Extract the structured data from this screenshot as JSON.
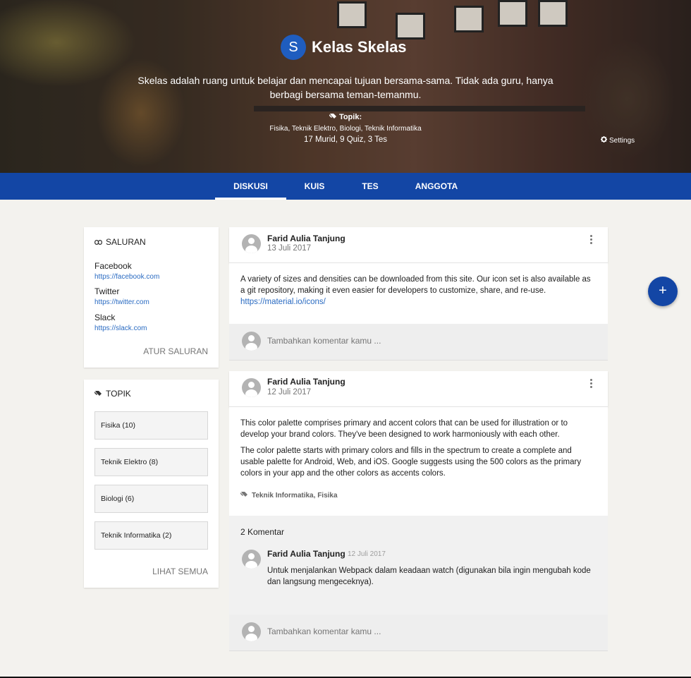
{
  "hero": {
    "avatar_letter": "S",
    "title": "Kelas Skelas",
    "description": "Skelas adalah ruang untuk belajar dan mencapai tujuan bersama-sama. Tidak ada guru, hanya berbagi bersama teman-temanmu.",
    "topic_label": "Topik:",
    "topics": "Fisika, Teknik Elektro, Biologi, Teknik Informatika",
    "stats": "17 Murid, 9 Quiz, 3 Tes",
    "settings_label": "Settings"
  },
  "tabs": [
    {
      "label": "DISKUSI",
      "active": true
    },
    {
      "label": "KUIS",
      "active": false
    },
    {
      "label": "TES",
      "active": false
    },
    {
      "label": "ANGGOTA",
      "active": false
    }
  ],
  "sidebar": {
    "channels": {
      "title": "SALURAN",
      "items": [
        {
          "name": "Facebook",
          "url": "https://facebook.com"
        },
        {
          "name": "Twitter",
          "url": "https://twitter.com"
        },
        {
          "name": "Slack",
          "url": "https://slack.com"
        }
      ],
      "action": "ATUR SALURAN"
    },
    "topics": {
      "title": "TOPIK",
      "items": [
        "Fisika (10)",
        "Teknik Elektro (8)",
        "Biologi (6)",
        "Teknik Informatika (2)"
      ],
      "action": "LIHAT SEMUA"
    }
  },
  "posts": [
    {
      "author": "Farid Aulia Tanjung",
      "date": "13 Juli 2017",
      "body": "A variety of sizes and densities can be downloaded from this site. Our icon set is also available as a git repository, making it even easier for developers to customize, share, and re-use.",
      "link": "https://material.io/icons/",
      "comment_placeholder": "Tambahkan komentar kamu ..."
    },
    {
      "author": "Farid Aulia Tanjung",
      "date": "12 Juli 2017",
      "para1": "This color palette comprises primary and accent colors that can be used for illustration or to develop your brand colors. They've been designed to work harmoniously with each other.",
      "para2": "The color palette starts with primary colors and fills in the spectrum to create a complete and usable palette for Android, Web, and iOS. Google suggests using the 500 colors as the primary colors in your app and the other colors as accents colors.",
      "tag1": "Teknik Informatika",
      "tag_sep": ",",
      "tag2": "Fisika",
      "comments_count": "2 Komentar",
      "comment": {
        "author": "Farid Aulia Tanjung",
        "date": "12 Juli 2017",
        "text": "Untuk menjalankan Webpack dalam keadaan watch (digunakan bila ingin mengubah kode dan langsung mengeceknya)."
      },
      "comment_placeholder": "Tambahkan komentar kamu ..."
    }
  ],
  "fab_label": "+",
  "colors": {
    "primary": "#1346a5",
    "link": "#2a6bc2",
    "background": "#f3f2ee"
  },
  "icons": [
    "link-icon",
    "tag-icon",
    "gear-icon",
    "more-vert-icon",
    "user-avatar-icon"
  ]
}
